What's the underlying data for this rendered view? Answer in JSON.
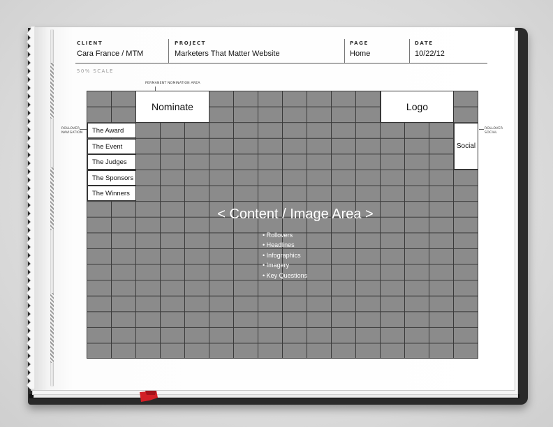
{
  "header": {
    "client": {
      "label": "CLIENT",
      "value": "Cara France / MTM"
    },
    "project": {
      "label": "PROJECT",
      "value": "Marketers That Matter Website"
    },
    "page": {
      "label": "PAGE",
      "value": "Home"
    },
    "date": {
      "label": "DATE",
      "value": "10/22/12"
    }
  },
  "scale_note": "50% SCALE",
  "annotations": {
    "permanent_nomination": "PERMANENT NOMINATION AREA",
    "rollover_navigation": [
      "ROLLOVER",
      "NAVIGATION"
    ],
    "rollover_social": [
      "ROLLOVER",
      "SOCIAL"
    ]
  },
  "wireframe": {
    "nominate_label": "Nominate",
    "logo_label": "Logo",
    "social_label": "Social",
    "nav_items": [
      "The Award",
      "The Event",
      "The Judges",
      "The Sponsors",
      "The Winners"
    ],
    "content_title": "< Content / Image Area >",
    "content_bullets": [
      "Rollovers",
      "Headlines",
      "Infographics",
      "Imagery",
      "Key Questions"
    ]
  },
  "colors": {
    "grid_fill": "#8b8b8b",
    "grid_lines": "#3a3a3a",
    "ribbon": "#d21f26",
    "cover": "#2a2a2a"
  }
}
